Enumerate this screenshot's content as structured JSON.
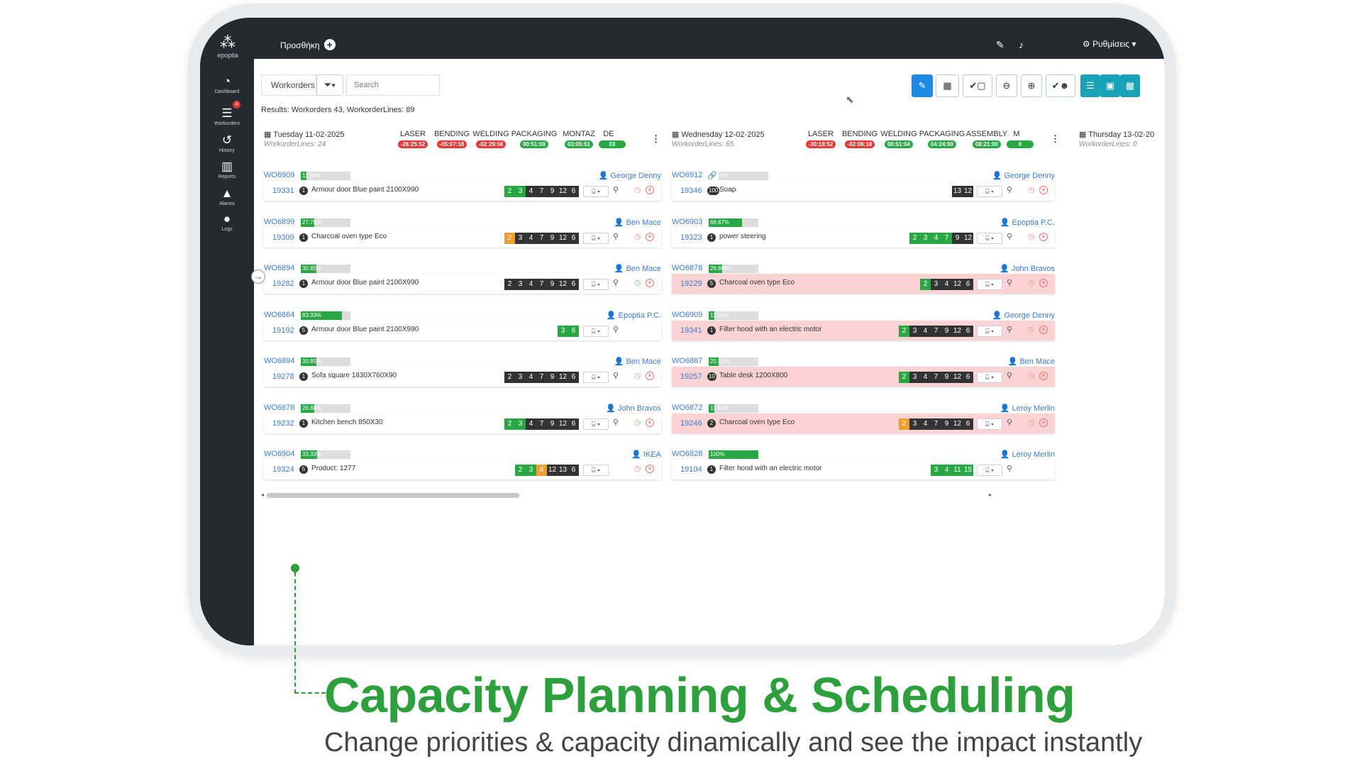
{
  "app": {
    "logo_text": "epoptia",
    "add_label": "Προσθήκη",
    "settings_label": "Ρυθμίσεις"
  },
  "sidebar": {
    "items": [
      {
        "label": "Dashboard",
        "icon": "dashboard-icon"
      },
      {
        "label": "Workorders",
        "icon": "list-icon",
        "badge": "4"
      },
      {
        "label": "History",
        "icon": "history-icon"
      },
      {
        "label": "Reports",
        "icon": "chart-icon"
      },
      {
        "label": "Alarms",
        "icon": "alert-icon"
      },
      {
        "label": "Logs",
        "icon": "chat-icon"
      }
    ]
  },
  "toolbar": {
    "view_label": "Workorders",
    "search_placeholder": "Search"
  },
  "results": "Results: Workorders 43, WorkorderLines: 89",
  "days": [
    {
      "date": "Tuesday 11-02-2025",
      "lines": "WorkorderLines: 24",
      "ops": [
        {
          "name": "LASER",
          "time": "-26:25:52",
          "status": "red"
        },
        {
          "name": "BENDING",
          "time": "-05:07:18",
          "status": "red"
        },
        {
          "name": "WELDING",
          "time": "-02:29:56",
          "status": "red"
        },
        {
          "name": "PACKAGING",
          "time": "00:51:00",
          "status": "green"
        },
        {
          "name": "MONTAZ",
          "time": "03:05:51",
          "status": "green"
        },
        {
          "name": "DE",
          "time": "03",
          "status": "green"
        }
      ],
      "workorders": [
        {
          "id": "WO6909",
          "progress": 11.54,
          "progress_label": "11.54%",
          "customer": "George Denny",
          "line_id": "19331",
          "qty": "1",
          "desc": "Armour door Blue paint 2100X990",
          "steps": [
            [
              "2",
              "g"
            ],
            [
              "3",
              "g"
            ],
            [
              "4",
              ""
            ],
            [
              "7",
              ""
            ],
            [
              "9",
              ""
            ],
            [
              "12",
              ""
            ],
            [
              "6",
              ""
            ]
          ],
          "pink": false,
          "clock": "red"
        },
        {
          "id": "WO6899",
          "progress": 27.78,
          "progress_label": "27.78%",
          "customer": "Ben Mace",
          "line_id": "19309",
          "qty": "1",
          "desc": "Charcoal oven type Eco",
          "steps": [
            [
              "2",
              "o"
            ],
            [
              "3",
              ""
            ],
            [
              "4",
              ""
            ],
            [
              "7",
              ""
            ],
            [
              "9",
              ""
            ],
            [
              "12",
              ""
            ],
            [
              "6",
              ""
            ]
          ],
          "pink": false,
          "clock": "red"
        },
        {
          "id": "WO6894",
          "progress": 30.85,
          "progress_label": "30.85%",
          "customer": "Ben Mace",
          "line_id": "19282",
          "qty": "1",
          "desc": "Armour door Blue paint 2100X990",
          "steps": [
            [
              "2",
              ""
            ],
            [
              "3",
              ""
            ],
            [
              "4",
              ""
            ],
            [
              "7",
              ""
            ],
            [
              "9",
              ""
            ],
            [
              "12",
              ""
            ],
            [
              "6",
              ""
            ]
          ],
          "pink": false,
          "clock": "green"
        },
        {
          "id": "WO6864",
          "progress": 83.33,
          "progress_label": "83.33%",
          "customer": "Epoptia P.C.",
          "line_id": "19192",
          "qty": "5",
          "desc": "Armour door Blue paint 2100X990",
          "steps": [
            [
              "3",
              "g"
            ],
            [
              "6",
              "g"
            ]
          ],
          "pink": false,
          "clock": "none"
        },
        {
          "id": "WO6894",
          "progress": 30.85,
          "progress_label": "30.85%",
          "customer": "Ben Mace",
          "line_id": "19278",
          "qty": "1",
          "desc": "Sofa square 1830X760X90",
          "steps": [
            [
              "2",
              ""
            ],
            [
              "3",
              ""
            ],
            [
              "4",
              ""
            ],
            [
              "7",
              ""
            ],
            [
              "9",
              ""
            ],
            [
              "12",
              ""
            ],
            [
              "6",
              ""
            ]
          ],
          "pink": false,
          "clock": "red"
        },
        {
          "id": "WO6878",
          "progress": 26.88,
          "progress_label": "26.88%",
          "customer": "John Bravos",
          "line_id": "19232",
          "qty": "1",
          "desc": "Kitchen bench 850X30",
          "steps": [
            [
              "2",
              "g"
            ],
            [
              "3",
              "g"
            ],
            [
              "4",
              ""
            ],
            [
              "7",
              ""
            ],
            [
              "9",
              ""
            ],
            [
              "12",
              ""
            ],
            [
              "6",
              ""
            ]
          ],
          "pink": false,
          "clock": "green"
        },
        {
          "id": "WO6904",
          "progress": 33.33,
          "progress_label": "33.33%",
          "customer": "IKEA",
          "line_id": "19324",
          "qty": "5",
          "desc": "Product: 1277",
          "steps": [
            [
              "2",
              "g"
            ],
            [
              "3",
              "g"
            ],
            [
              "4",
              "o"
            ],
            [
              "12",
              ""
            ],
            [
              "13",
              ""
            ],
            [
              "6",
              ""
            ]
          ],
          "pink": false,
          "clock": "red",
          "no_attach": true
        }
      ]
    },
    {
      "date": "Wednesday 12-02-2025",
      "lines": "WorkorderLines: 65",
      "ops": [
        {
          "name": "LASER",
          "time": "-30:18:52",
          "status": "red"
        },
        {
          "name": "BENDING",
          "time": "-02:06:18",
          "status": "red"
        },
        {
          "name": "WELDING",
          "time": "00:51:04",
          "status": "green"
        },
        {
          "name": "PACKAGING",
          "time": "04:24:00",
          "status": "green"
        },
        {
          "name": "ASSEMBLY",
          "time": "08:21:00",
          "status": "green"
        },
        {
          "name": "M",
          "time": "0",
          "status": "green"
        }
      ],
      "workorders": [
        {
          "id": "WO6912",
          "progress": 0,
          "progress_label": "0%",
          "customer": "George Denny",
          "line_id": "19346",
          "qty": "100",
          "desc": "Soap",
          "steps": [
            [
              "13",
              ""
            ],
            [
              "12",
              ""
            ]
          ],
          "pink": false,
          "clock": "red",
          "clip": true
        },
        {
          "id": "WO6903",
          "progress": 66.67,
          "progress_label": "66.67%",
          "customer": "Epoptia P.C.",
          "line_id": "19323",
          "qty": "1",
          "desc": "power steering",
          "steps": [
            [
              "2",
              "g"
            ],
            [
              "3",
              "g"
            ],
            [
              "4",
              "g"
            ],
            [
              "7",
              "g"
            ],
            [
              "9",
              ""
            ],
            [
              "12",
              ""
            ]
          ],
          "pink": false,
          "clock": "red"
        },
        {
          "id": "WO6878",
          "progress": 26.88,
          "progress_label": "26.88%",
          "customer": "John Bravos",
          "line_id": "19229",
          "qty": "5",
          "desc": "Charcoal oven type Eco",
          "steps": [
            [
              "2",
              "g"
            ],
            [
              "3",
              ""
            ],
            [
              "4",
              ""
            ],
            [
              "12",
              ""
            ],
            [
              "6",
              ""
            ]
          ],
          "pink": true,
          "clock": "red"
        },
        {
          "id": "WO6909",
          "progress": 11.54,
          "progress_label": "11.54%",
          "customer": "George Denny",
          "line_id": "19341",
          "qty": "1",
          "desc": "Filter hood with an electric motor",
          "steps": [
            [
              "2",
              "g"
            ],
            [
              "3",
              ""
            ],
            [
              "4",
              ""
            ],
            [
              "7",
              ""
            ],
            [
              "9",
              ""
            ],
            [
              "12",
              ""
            ],
            [
              "6",
              ""
            ]
          ],
          "pink": true,
          "clock": "red"
        },
        {
          "id": "WO6887",
          "progress": 20.31,
          "progress_label": "20.31%",
          "customer": "Ben Mace",
          "line_id": "19257",
          "qty": "10",
          "desc": "Table desk 1200X800",
          "steps": [
            [
              "2",
              "g"
            ],
            [
              "3",
              ""
            ],
            [
              "4",
              ""
            ],
            [
              "7",
              ""
            ],
            [
              "9",
              ""
            ],
            [
              "12",
              ""
            ],
            [
              "6",
              ""
            ]
          ],
          "pink": true,
          "clock": "red"
        },
        {
          "id": "WO6872",
          "progress": 11.54,
          "progress_label": "11.54%",
          "customer": "Leroy Merlin",
          "line_id": "19246",
          "qty": "2",
          "desc": "Charcoal oven type Eco",
          "steps": [
            [
              "2",
              "o"
            ],
            [
              "3",
              ""
            ],
            [
              "4",
              ""
            ],
            [
              "7",
              ""
            ],
            [
              "9",
              ""
            ],
            [
              "12",
              ""
            ],
            [
              "6",
              ""
            ]
          ],
          "pink": true,
          "clock": "red"
        },
        {
          "id": "WO6828",
          "progress": 100,
          "progress_label": "100%",
          "customer": "Leroy Merlin",
          "line_id": "19104",
          "qty": "1",
          "desc": "Filter hood with an electric motor",
          "steps": [
            [
              "3",
              "g"
            ],
            [
              "4",
              "g"
            ],
            [
              "11",
              "g"
            ],
            [
              "15",
              "g"
            ]
          ],
          "pink": false,
          "clock": "none"
        }
      ]
    },
    {
      "date": "Thursday 13-02-20",
      "lines": "WorkorderLines: 0",
      "ops": [],
      "workorders": []
    }
  ],
  "caption": {
    "headline": "Capacity Planning & Scheduling",
    "subline": "Change priorities & capacity dinamically and see the impact instantly"
  },
  "colors": {
    "accent_green": "#2d9f3d",
    "primary_blue": "#1e88e5",
    "teal": "#17a2b8",
    "alert_red": "#e53935",
    "sidebar": "#232a30"
  }
}
